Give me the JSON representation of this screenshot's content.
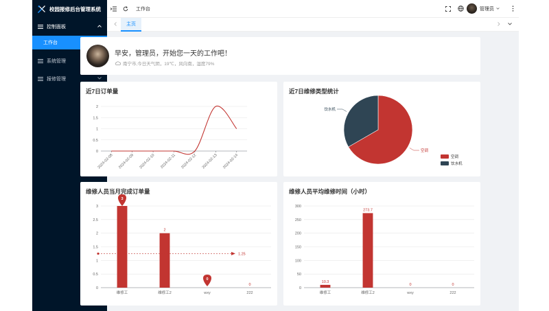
{
  "sidebar": {
    "brand": "校园报修后台管理系统",
    "groups": [
      {
        "label": "控制面板",
        "expanded": true
      },
      {
        "label": "系统管理",
        "expanded": false
      },
      {
        "label": "报修管理",
        "expanded": false
      }
    ],
    "active_item": "工作台",
    "colors": {
      "bg": "#001529",
      "active": "#1890ff"
    }
  },
  "header": {
    "breadcrumb": "工作台",
    "username": "管理员",
    "icons": [
      "menu-fold-icon",
      "refresh-icon",
      "fullscreen-icon",
      "globe-icon",
      "more-icon"
    ]
  },
  "tabs": {
    "items": [
      "主页"
    ]
  },
  "welcome": {
    "greeting": "早安，管理员，开始您一天的工作吧！",
    "weather": "南宁市,今日天气阴，19℃，风向南，湿度79%"
  },
  "charts": {
    "accent": "#c23531",
    "dark": "#2f4554"
  },
  "chart_data": [
    {
      "type": "line",
      "title": "近7日订单量",
      "x": [
        "2024-02-08",
        "2024-02-09",
        "2024-02-10",
        "2024-02-11",
        "2024-02-12",
        "2024-02-13",
        "2024-02-14"
      ],
      "values": [
        0,
        0,
        0,
        0,
        0,
        2,
        1
      ],
      "yticks": [
        0,
        0.5,
        1,
        1.5,
        2
      ],
      "ylim": [
        0,
        2
      ]
    },
    {
      "type": "pie",
      "title": "近7日维修类型统计",
      "slices": [
        {
          "name": "空调",
          "value": 2
        },
        {
          "name": "饮水机",
          "value": 1
        }
      ],
      "legend": "bottom-right"
    },
    {
      "type": "bar",
      "title": "维修人员当月完成订单量",
      "categories": [
        "维修工",
        "维修工2",
        "wxy",
        "222"
      ],
      "values": [
        3,
        2,
        0,
        0
      ],
      "value_labels": [
        "",
        "2",
        "",
        "0"
      ],
      "max_marker": "3",
      "min_marker": "0",
      "average_label": "1.25",
      "yticks": [
        "0",
        "0.5",
        "1",
        "1.5",
        "2",
        "2.5",
        "3"
      ],
      "ylim": [
        0,
        3
      ]
    },
    {
      "type": "bar",
      "title": "维修人员平均维修时间（小时）",
      "categories": [
        "维修工",
        "维修工2",
        "wxy",
        "222"
      ],
      "values": [
        10.3,
        273.7,
        0,
        0
      ],
      "value_labels": [
        "10.3",
        "273.7",
        "0",
        "0"
      ],
      "yticks": [
        "0",
        "50",
        "100",
        "150",
        "200",
        "250",
        "300"
      ],
      "ylim": [
        0,
        300
      ]
    }
  ]
}
